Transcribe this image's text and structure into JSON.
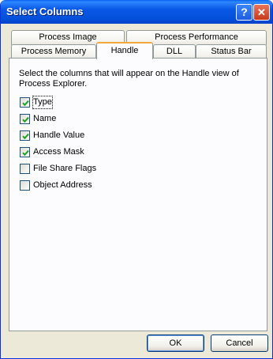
{
  "window": {
    "title": "Select Columns",
    "help_label": "?",
    "close_label": "✕"
  },
  "tabs": {
    "row_back": [
      {
        "label": "Process Image"
      },
      {
        "label": "Process Performance"
      }
    ],
    "row_front": [
      {
        "label": "Process Memory"
      },
      {
        "label": "Handle",
        "selected": true
      },
      {
        "label": "DLL"
      },
      {
        "label": "Status Bar"
      }
    ]
  },
  "panel": {
    "description": "Select the columns that will appear on the Handle view of Process Explorer.",
    "options": [
      {
        "label": "Type",
        "checked": true
      },
      {
        "label": "Name",
        "checked": true
      },
      {
        "label": "Handle Value",
        "checked": true
      },
      {
        "label": "Access Mask",
        "checked": true
      },
      {
        "label": "File Share Flags",
        "checked": false
      },
      {
        "label": "Object Address",
        "checked": false
      }
    ]
  },
  "buttons": {
    "ok": "OK",
    "cancel": "Cancel"
  },
  "colors": {
    "titlebar": "#0858E6",
    "dialog_bg": "#ECE9D8",
    "tab_highlight": "#F2A93B",
    "checkmark": "#21A121"
  }
}
